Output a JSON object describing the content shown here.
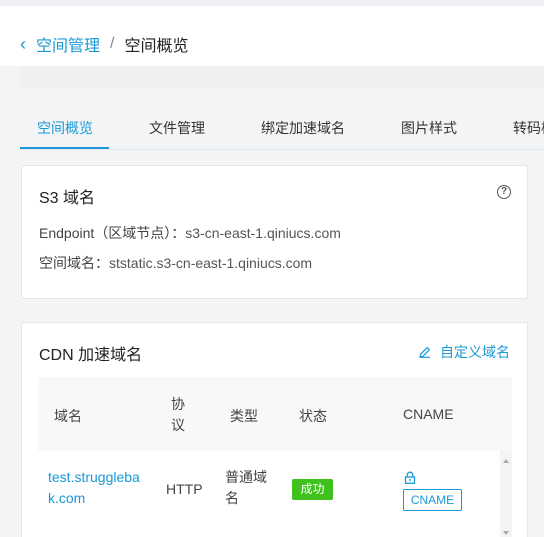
{
  "breadcrumb": {
    "back_icon": "chevron-left-icon",
    "parent": "空间管理",
    "separator": "/",
    "current": "空间概览"
  },
  "tabs": [
    {
      "label": "空间概览",
      "active": true
    },
    {
      "label": "文件管理",
      "active": false
    },
    {
      "label": "绑定加速域名",
      "active": false
    },
    {
      "label": "图片样式",
      "active": false
    },
    {
      "label": "转码样",
      "active": false
    }
  ],
  "s3_card": {
    "title": "S3 域名",
    "help_icon": "question-circle-icon",
    "endpoint_label": "Endpoint（区域节点）：",
    "endpoint_value": "s3-cn-east-1.qiniucs.com",
    "space_domain_label": "空间域名：",
    "space_domain_value": "ststatic.s3-cn-east-1.qiniucs.com"
  },
  "cdn_card": {
    "title": "CDN 加速域名",
    "custom_domain_label": "自定义域名",
    "custom_domain_icon": "edit-icon",
    "columns": [
      "域名",
      "协\n议",
      "类型",
      "状态",
      "CNAME"
    ],
    "rows": [
      {
        "domain": "test.strugglebak.com",
        "protocol": "HTTP",
        "type": "普通域名",
        "status": "成功",
        "cname_icon": "lock-icon",
        "cname_label": "CNAME"
      }
    ]
  },
  "colors": {
    "accent": "#1a99d6",
    "success": "#3ec21b"
  }
}
